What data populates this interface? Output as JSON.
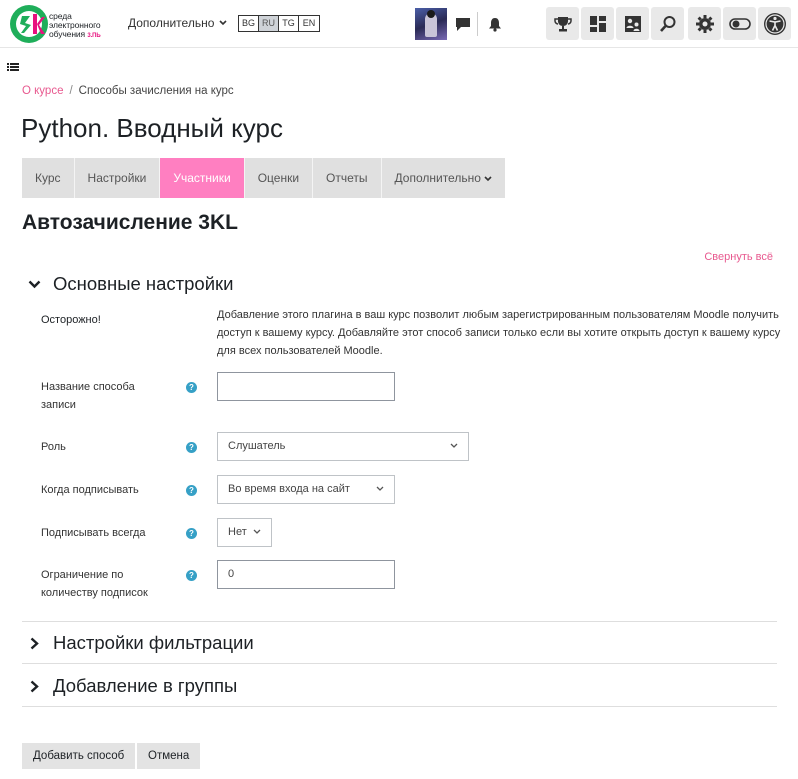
{
  "navbar": {
    "logo_text_line1": "среда",
    "logo_text_line2": "электронного",
    "logo_text_line3": "обучения",
    "logo_brand": "3.ПЬ",
    "more_label": "Дополнительно",
    "languages": [
      "BG",
      "RU",
      "TG",
      "EN"
    ],
    "active_language": "RU"
  },
  "breadcrumb": {
    "items": [
      "О курсе",
      "Способы зачисления на курс"
    ]
  },
  "page_title": "Python. Вводный курс",
  "tabs": [
    {
      "label": "Курс"
    },
    {
      "label": "Настройки"
    },
    {
      "label": "Участники"
    },
    {
      "label": "Оценки"
    },
    {
      "label": "Отчеты"
    },
    {
      "label": "Дополнительно"
    }
  ],
  "active_tab": "Участники",
  "section_title": "Автозачисление 3KL",
  "collapse_all": "Свернуть всё",
  "fieldsets": {
    "general": "Основные настройки",
    "filter": "Настройки фильтрации",
    "groups": "Добавление в группы"
  },
  "warning": {
    "label": "Осторожно!",
    "text": "Добавление этого плагина в ваш курс позволит любым зарегистрированным пользователям Moodle получить доступ к вашему курсу. Добавляйте этот способ записи только если вы хотите открыть доступ к вашему курсу для всех пользователей Moodle."
  },
  "form": {
    "name": {
      "label": "Название способа записи",
      "value": ""
    },
    "role": {
      "label": "Роль",
      "value": "Слушатель"
    },
    "when": {
      "label": "Когда подписывать",
      "value": "Во время входа на сайт"
    },
    "always": {
      "label": "Подписывать всегда",
      "value": "Нет"
    },
    "limit": {
      "label": "Ограничение по количеству подписок",
      "value": "0"
    }
  },
  "buttons": {
    "submit": "Добавить способ",
    "cancel": "Отмена"
  },
  "colors": {
    "accent": "#ff7fc1",
    "link": "#e8598f",
    "help": "#36a0c6"
  }
}
